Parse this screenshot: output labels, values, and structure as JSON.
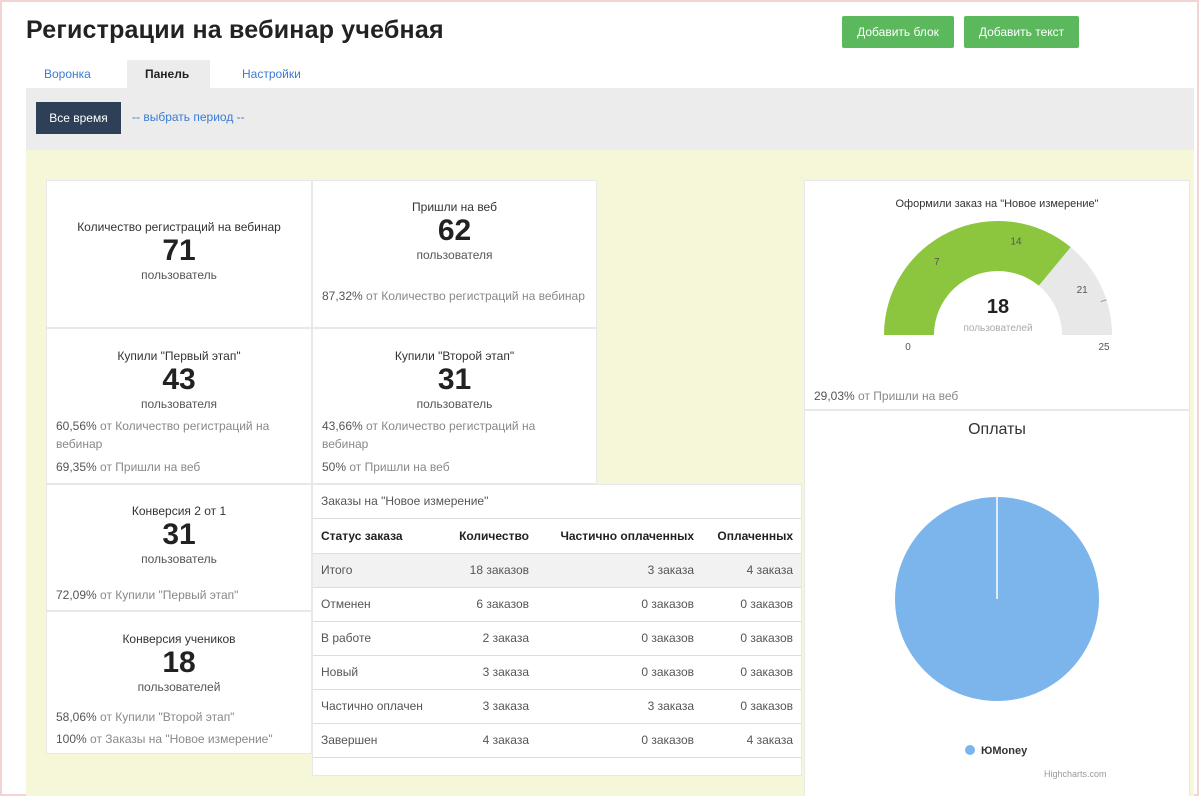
{
  "header": {
    "title": "Регистрации на вебинар учебная",
    "add_block": "Добавить блок",
    "add_text": "Добавить текст"
  },
  "tabs": [
    {
      "label": "Воронка"
    },
    {
      "label": "Панель"
    },
    {
      "label": "Настройки"
    }
  ],
  "filter": {
    "all_time": "Все время",
    "choose_period": "-- выбрать период --"
  },
  "cards": {
    "registrations": {
      "label": "Количество регистраций на вебинар",
      "value": "71",
      "unit": "пользователь"
    },
    "came": {
      "label": "Пришли на веб",
      "value": "62",
      "unit": "пользователя",
      "note_pct": "87,32%",
      "note_text": " от Количество регистраций на вебинар"
    },
    "bought1": {
      "label": "Купили \"Первый этап\"",
      "value": "43",
      "unit": "пользователя",
      "note1_pct": "60,56%",
      "note1_text": " от Количество регистраций на вебинар",
      "note2_pct": "69,35%",
      "note2_text": " от Пришли на веб"
    },
    "bought2": {
      "label": "Купили \"Второй этап\"",
      "value": "31",
      "unit": "пользователь",
      "note1_pct": "43,66%",
      "note1_text": " от Количество регистраций на вебинар",
      "note2_pct": "50%",
      "note2_text": " от Пришли на веб"
    },
    "conv21": {
      "label": "Конверсия 2 от 1",
      "value": "31",
      "unit": "пользователь",
      "note_pct": "72,09%",
      "note_text": " от Купили \"Первый этап\""
    },
    "conv_students": {
      "label": "Конверсия учеников",
      "value": "18",
      "unit": "пользователей",
      "note1_pct": "58,06%",
      "note1_text": " от Купили \"Второй этап\"",
      "note2_pct": "100%",
      "note2_text": " от Заказы на \"Новое измерение\""
    }
  },
  "orders": {
    "title": "Заказы на \"Новое измерение\"",
    "headers": [
      "Статус заказа",
      "Количество",
      "Частично оплаченных",
      "Оплаченных"
    ],
    "rows": [
      [
        "Итого",
        "18 заказов",
        "3 заказа",
        "4 заказа"
      ],
      [
        "Отменен",
        "6 заказов",
        "0 заказов",
        "0 заказов"
      ],
      [
        "В работе",
        "2 заказа",
        "0 заказов",
        "0 заказов"
      ],
      [
        "Новый",
        "3 заказа",
        "0 заказов",
        "0 заказов"
      ],
      [
        "Частично оплачен",
        "3 заказа",
        "3 заказа",
        "0 заказов"
      ],
      [
        "Завершен",
        "4 заказа",
        "0 заказов",
        "4 заказа"
      ]
    ]
  },
  "gauge": {
    "title": "Оформили заказ на \"Новое измерение\"",
    "value": 18,
    "value_text": "18",
    "unit": "пользователей",
    "min": 0,
    "max": 25,
    "min_label": "0",
    "max_label": "25",
    "tick_labels": [
      "7",
      "14",
      "21"
    ],
    "note_pct": "29,03%",
    "note_text": " от Пришли на веб",
    "colors": {
      "fill": "#8cc63f",
      "track": "#e8e8e8"
    }
  },
  "pie": {
    "title": "Оплаты",
    "legend": "ЮMoney",
    "credit": "Highcharts.com",
    "series": [
      {
        "name": "ЮMoney",
        "value": 100,
        "color": "#7cb5ec"
      }
    ]
  }
}
